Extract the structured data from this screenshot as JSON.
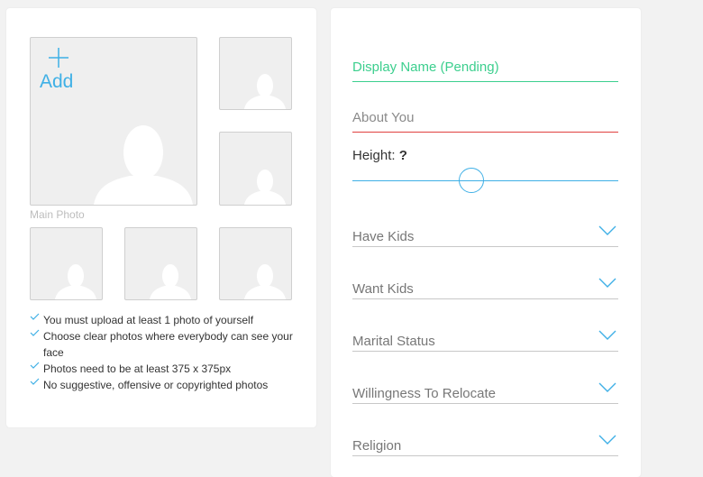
{
  "photos": {
    "add_label": "Add",
    "main_photo_label": "Main Photo",
    "tips": [
      "You must upload at least 1 photo of yourself",
      "Choose clear photos where everybody can see your face",
      "Photos need to be at least 375 x 375px",
      "No suggestive, offensive or copyrighted photos"
    ]
  },
  "form": {
    "display_name_placeholder": "Display Name (Pending)",
    "about_placeholder": "About You",
    "height_label": "Height:",
    "height_value": "?",
    "selects": [
      "Have Kids",
      "Want Kids",
      "Marital Status",
      "Willingness To Relocate",
      "Religion"
    ]
  },
  "colors": {
    "accent": "#3fb0e6",
    "valid_green": "#3ccf8e",
    "error_red": "#e0413f"
  },
  "icons": {
    "add": "plus-icon",
    "placeholder": "person-silhouette-icon",
    "tip": "checkmark-icon",
    "select": "chevron-down-icon"
  }
}
